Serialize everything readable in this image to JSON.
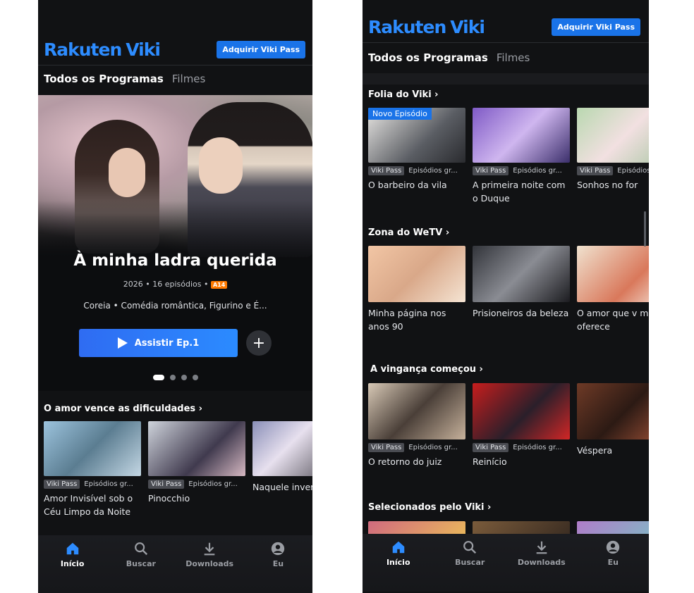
{
  "app": {
    "logo_rakuten": "Rakuten",
    "logo_viki": "Viki",
    "pass_button": "Adquirir Viki Pass"
  },
  "tabs": [
    {
      "label": "Todos os Programas"
    },
    {
      "label": "Filmes"
    }
  ],
  "hero": {
    "title": "À minha ladra querida",
    "meta": "2026 • 16 episódios •",
    "rating": "A14",
    "genres": "Coreia • Comédia romântica, Figurino e É...",
    "watch_button": "Assistir Ep.1",
    "add_button": "+"
  },
  "left_row": {
    "title": "O amor vence as dificuldades ›",
    "items": [
      {
        "badge": "Viki Pass",
        "subbadge": "Episódios gr...",
        "title": "Amor Invisível sob o Céu Limpo da Noite"
      },
      {
        "badge": "Viki Pass",
        "subbadge": "Episódios gr...",
        "title": "Pinocchio"
      },
      {
        "badge": "",
        "subbadge": "",
        "title": "Naquele inverno, o vento soprou"
      }
    ]
  },
  "right_rows": [
    {
      "title": "Folia do Viki ›",
      "items": [
        {
          "overlay": "Novo Episódio",
          "badge": "Viki Pass",
          "subbadge": "Episódios gr...",
          "title": "O barbeiro da vila"
        },
        {
          "badge": "Viki Pass",
          "subbadge": "Episódios gr...",
          "title": "A primeira noite com o Duque"
        },
        {
          "badge": "Viki Pass",
          "subbadge": "Episódios gr...",
          "title": "Sonhos no for"
        }
      ]
    },
    {
      "title": "Zona do WeTV ›",
      "items": [
        {
          "title": "Minha página nos anos 90"
        },
        {
          "title": "Prisioneiros da beleza"
        },
        {
          "title": "O amor que v me oferece"
        }
      ]
    },
    {
      "title": "A vingança começou ›",
      "items": [
        {
          "badge": "Viki Pass",
          "subbadge": "Episódios gr...",
          "title": "O retorno do juiz"
        },
        {
          "badge": "Viki Pass",
          "subbadge": "Episódios gr...",
          "title": "Reinício"
        },
        {
          "title": "Véspera"
        }
      ]
    },
    {
      "title": "Selecionados pelo Viki ›"
    }
  ],
  "nav": [
    {
      "label": "Início",
      "icon": "home-icon"
    },
    {
      "label": "Buscar",
      "icon": "search-icon"
    },
    {
      "label": "Downloads",
      "icon": "download-icon"
    },
    {
      "label": "Eu",
      "icon": "profile-icon"
    }
  ],
  "colors": {
    "accent": "#1a73e8",
    "background": "#111214",
    "logo": "#2d8cff"
  }
}
